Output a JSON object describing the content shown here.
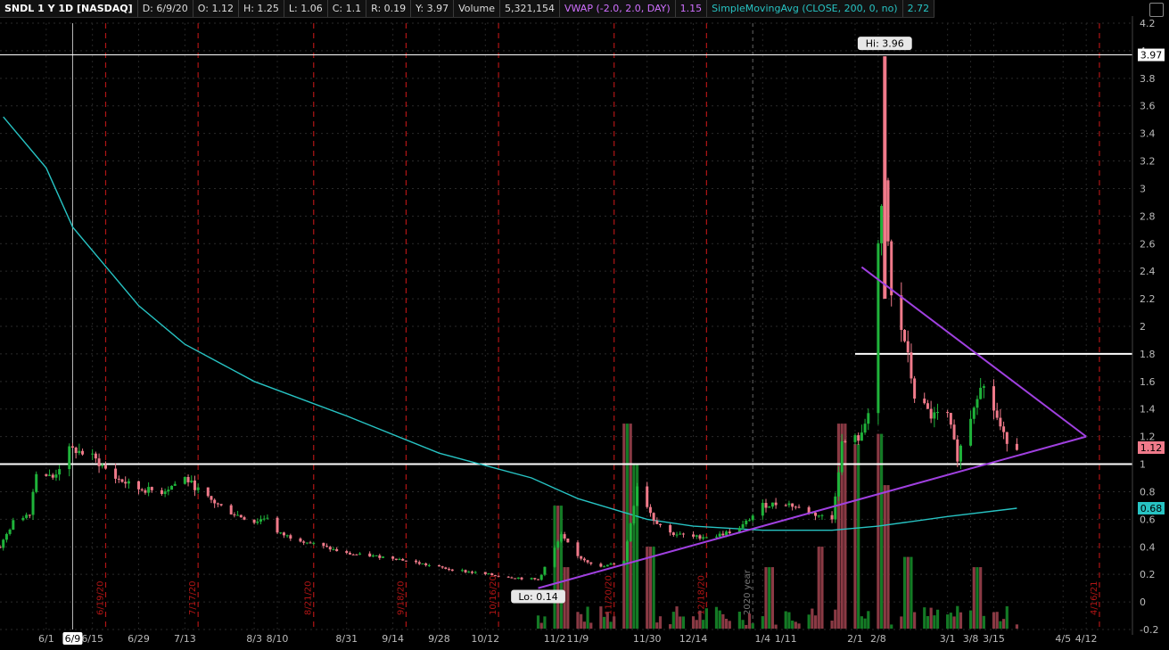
{
  "header": {
    "symbol": "SNDL 1 Y 1D [NASDAQ]",
    "date": "D: 6/9/20",
    "open": "O: 1.12",
    "high": "H: 1.25",
    "low": "L: 1.06",
    "close": "C: 1.1",
    "range": "R: 0.19",
    "y": "Y: 3.97",
    "volume_label": "Volume",
    "volume_value": "5,321,154",
    "vwap_label": "VWAP (-2.0, 2.0, DAY)",
    "vwap_value": "1.15",
    "sma_label": "SimpleMovingAvg (CLOSE, 200, 0, no)",
    "sma_value": "2.72"
  },
  "colors": {
    "up": "#1fb33a",
    "down": "#f07a8a",
    "sma": "#27c3c3",
    "trend": "#a040e0",
    "level": "#ffffff"
  },
  "chart_data": {
    "type": "candlestick",
    "title": "SNDL 1 Y 1D [NASDAQ]",
    "y_range": [
      -0.2,
      4.2
    ],
    "y_ticks": [
      -0.2,
      0,
      0.2,
      0.4,
      0.6,
      0.8,
      1,
      1.2,
      1.4,
      1.6,
      1.8,
      2,
      2.2,
      2.4,
      2.6,
      2.8,
      3,
      3.2,
      3.4,
      3.6,
      3.8,
      4,
      4.2
    ],
    "x_range": [
      "2020-05-18",
      "2021-04-26"
    ],
    "x_ticks": [
      {
        "date": "2020-06-01",
        "label": "6/1"
      },
      {
        "date": "2020-06-09",
        "label": "6/9"
      },
      {
        "date": "2020-06-15",
        "label": "6/15"
      },
      {
        "date": "2020-06-29",
        "label": "6/29"
      },
      {
        "date": "2020-07-13",
        "label": "7/13"
      },
      {
        "date": "2020-08-03",
        "label": "8/3"
      },
      {
        "date": "2020-08-10",
        "label": "8/10"
      },
      {
        "date": "2020-08-31",
        "label": "8/31"
      },
      {
        "date": "2020-09-14",
        "label": "9/14"
      },
      {
        "date": "2020-09-28",
        "label": "9/28"
      },
      {
        "date": "2020-10-12",
        "label": "10/12"
      },
      {
        "date": "2020-11-02",
        "label": "11/2"
      },
      {
        "date": "2020-11-09",
        "label": "11/9"
      },
      {
        "date": "2020-11-30",
        "label": "11/30"
      },
      {
        "date": "2020-12-14",
        "label": "12/14"
      },
      {
        "date": "2021-01-04",
        "label": "1/4"
      },
      {
        "date": "2021-01-11",
        "label": "1/11"
      },
      {
        "date": "2021-02-01",
        "label": "2/1"
      },
      {
        "date": "2021-02-08",
        "label": "2/8"
      },
      {
        "date": "2021-03-01",
        "label": "3/1"
      },
      {
        "date": "2021-03-08",
        "label": "3/8"
      },
      {
        "date": "2021-03-15",
        "label": "3/15"
      },
      {
        "date": "2021-04-05",
        "label": "4/5"
      },
      {
        "date": "2021-04-12",
        "label": "4/12"
      }
    ],
    "earnings_dates": [
      {
        "date": "2020-06-19",
        "label": "6/19/20"
      },
      {
        "date": "2020-07-17",
        "label": "7/17/20"
      },
      {
        "date": "2020-08-21",
        "label": "8/21/20"
      },
      {
        "date": "2020-09-18",
        "label": "9/18/20"
      },
      {
        "date": "2020-10-16",
        "label": "10/16/20"
      },
      {
        "date": "2020-11-20",
        "label": "11/20/20"
      },
      {
        "date": "2020-12-18",
        "label": "12/18/20"
      },
      {
        "date": "2021-04-16",
        "label": "4/16/21"
      }
    ],
    "year_marker": {
      "date": "2021-01-01",
      "label": "2020 year"
    },
    "cursor_date": "2020-06-09",
    "highest": {
      "date": "2021-02-10",
      "value": 3.96,
      "label": "Hi: 3.96"
    },
    "lowest": {
      "date": "2020-10-28",
      "value": 0.14,
      "label": "Lo: 0.14"
    },
    "horizontal_levels": [
      {
        "value": 3.97,
        "label": "3.97",
        "color": "#ffffff"
      },
      {
        "value": 1.0,
        "label": "",
        "color": "#ffffff"
      },
      {
        "value": 1.8,
        "label": "",
        "color": "#ffffff",
        "from": "2021-02-01",
        "to": "2021-04-26"
      }
    ],
    "price_tags": [
      {
        "value": 3.97,
        "label": "3.97",
        "bg": "#ffffff",
        "fg": "#000000"
      },
      {
        "value": 1.12,
        "label": "1.12",
        "bg": "#f07a8a",
        "fg": "#000000"
      },
      {
        "value": 0.68,
        "label": "0.68",
        "bg": "#27c3c3",
        "fg": "#000000"
      }
    ],
    "trendlines": [
      {
        "from": [
          "2020-10-28",
          0.1
        ],
        "to": [
          "2021-04-12",
          1.2
        ]
      },
      {
        "from": [
          "2021-02-03",
          2.43
        ],
        "to": [
          "2021-04-12",
          1.2
        ]
      }
    ],
    "price_path": [
      [
        "2020-05-18",
        0.4
      ],
      [
        "2020-05-22",
        0.58
      ],
      [
        "2020-05-27",
        0.65
      ],
      [
        "2020-05-29",
        0.95
      ],
      [
        "2020-06-03",
        0.9
      ],
      [
        "2020-06-08",
        1.1
      ],
      [
        "2020-06-10",
        1.1
      ],
      [
        "2020-06-15",
        1.05
      ],
      [
        "2020-06-22",
        0.9
      ],
      [
        "2020-06-29",
        0.82
      ],
      [
        "2020-07-06",
        0.8
      ],
      [
        "2020-07-13",
        0.9
      ],
      [
        "2020-07-20",
        0.75
      ],
      [
        "2020-07-27",
        0.65
      ],
      [
        "2020-08-03",
        0.58
      ],
      [
        "2020-08-07",
        0.62
      ],
      [
        "2020-08-10",
        0.5
      ],
      [
        "2020-08-17",
        0.45
      ],
      [
        "2020-08-31",
        0.35
      ],
      [
        "2020-09-14",
        0.32
      ],
      [
        "2020-09-28",
        0.25
      ],
      [
        "2020-10-12",
        0.2
      ],
      [
        "2020-10-28",
        0.16
      ],
      [
        "2020-11-04",
        0.48
      ],
      [
        "2020-11-09",
        0.33
      ],
      [
        "2020-11-16",
        0.25
      ],
      [
        "2020-11-23",
        0.3
      ],
      [
        "2020-11-27",
        0.85
      ],
      [
        "2020-12-02",
        0.6
      ],
      [
        "2020-12-07",
        0.5
      ],
      [
        "2020-12-14",
        0.47
      ],
      [
        "2020-12-21",
        0.48
      ],
      [
        "2020-12-28",
        0.53
      ],
      [
        "2021-01-04",
        0.7
      ],
      [
        "2021-01-11",
        0.72
      ],
      [
        "2021-01-18",
        0.65
      ],
      [
        "2021-01-25",
        0.6
      ],
      [
        "2021-01-28",
        1.15
      ],
      [
        "2021-02-03",
        1.2
      ],
      [
        "2021-02-05",
        1.4
      ],
      [
        "2021-02-08",
        2.6
      ],
      [
        "2021-02-10",
        3.0
      ],
      [
        "2021-02-12",
        2.2
      ],
      [
        "2021-02-16",
        1.9
      ],
      [
        "2021-02-19",
        1.5
      ],
      [
        "2021-02-24",
        1.35
      ],
      [
        "2021-03-01",
        1.35
      ],
      [
        "2021-03-04",
        1.05
      ],
      [
        "2021-03-08",
        1.35
      ],
      [
        "2021-03-11",
        1.6
      ],
      [
        "2021-03-15",
        1.4
      ],
      [
        "2021-03-18",
        1.2
      ],
      [
        "2021-03-22",
        1.12
      ]
    ],
    "sma_200": [
      [
        "2020-05-19",
        3.52
      ],
      [
        "2020-06-01",
        3.15
      ],
      [
        "2020-06-09",
        2.72
      ],
      [
        "2020-06-29",
        2.15
      ],
      [
        "2020-07-13",
        1.87
      ],
      [
        "2020-08-03",
        1.6
      ],
      [
        "2020-08-31",
        1.35
      ],
      [
        "2020-09-28",
        1.08
      ],
      [
        "2020-10-26",
        0.9
      ],
      [
        "2020-11-09",
        0.75
      ],
      [
        "2020-11-30",
        0.6
      ],
      [
        "2020-12-14",
        0.55
      ],
      [
        "2021-01-04",
        0.52
      ],
      [
        "2021-01-25",
        0.52
      ],
      [
        "2021-02-08",
        0.55
      ],
      [
        "2021-03-01",
        0.62
      ],
      [
        "2021-03-22",
        0.68
      ]
    ],
    "volume_bars_relative": [
      [
        "2020-11-03",
        0.6
      ],
      [
        "2020-11-05",
        0.3
      ],
      [
        "2020-11-24",
        1.0
      ],
      [
        "2020-11-27",
        0.8
      ],
      [
        "2020-12-01",
        0.4
      ],
      [
        "2021-01-06",
        0.3
      ],
      [
        "2021-01-22",
        0.4
      ],
      [
        "2021-01-28",
        1.0
      ],
      [
        "2021-02-01",
        0.9
      ],
      [
        "2021-02-08",
        0.95
      ],
      [
        "2021-02-10",
        0.7
      ],
      [
        "2021-02-17",
        0.35
      ],
      [
        "2021-03-10",
        0.3
      ]
    ]
  }
}
